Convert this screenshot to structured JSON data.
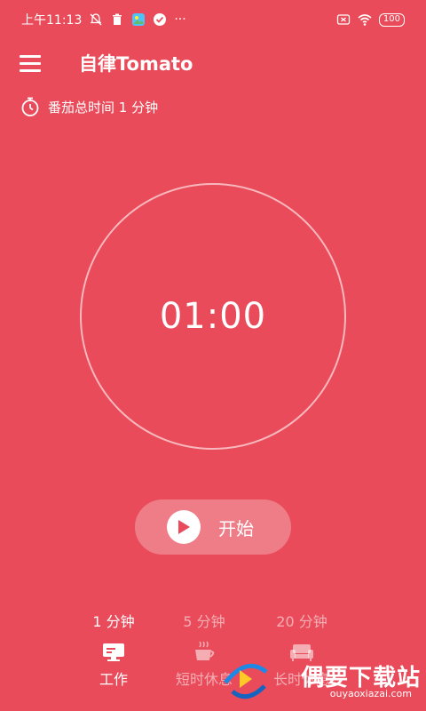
{
  "status_bar": {
    "time": "上午11:13",
    "battery": "100",
    "more": "···"
  },
  "app_bar": {
    "title": "自律Tomato"
  },
  "stats": {
    "total_time_label": "番茄总时间 1 分钟"
  },
  "timer": {
    "display": "01:00"
  },
  "start_button": {
    "label": "开始"
  },
  "modes": [
    {
      "duration": "1 分钟",
      "label": "工作",
      "icon": "monitor-icon",
      "active": true
    },
    {
      "duration": "5 分钟",
      "label": "短时休息",
      "icon": "coffee-icon",
      "active": false
    },
    {
      "duration": "20 分钟",
      "label": "长时休息",
      "icon": "sofa-icon",
      "active": false
    }
  ],
  "watermark": {
    "text": "偶要下载站",
    "url_text": "ouyaoxiazai.com"
  },
  "colors": {
    "background": "#E94B5A",
    "accent": "#E94B5A",
    "text": "#FFFFFF"
  }
}
